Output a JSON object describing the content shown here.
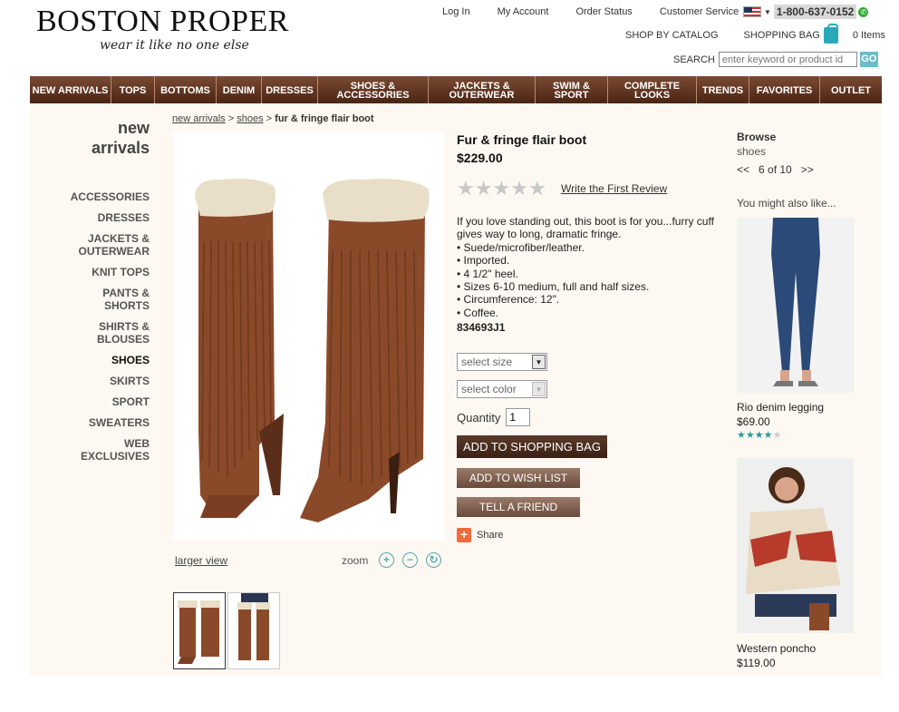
{
  "header": {
    "brand": "BOSTON PROPER",
    "tagline": "wear it like no one else",
    "links": [
      "Log In",
      "My Account",
      "Order Status",
      "Customer Service"
    ],
    "phone": "1-800-637-0152",
    "shop_by_catalog": "SHOP BY CATALOG",
    "shopping_bag": "SHOPPING BAG",
    "bag_count": "0 Items",
    "search_label": "SEARCH",
    "search_placeholder": "enter keyword or product id",
    "go": "GO"
  },
  "nav": [
    "NEW ARRIVALS",
    "TOPS",
    "BOTTOMS",
    "DENIM",
    "DRESSES",
    "SHOES & ACCESSORIES",
    "JACKETS & OUTERWEAR",
    "SWIM & SPORT",
    "COMPLETE LOOKS",
    "TRENDS",
    "FAVORITES",
    "OUTLET"
  ],
  "sidebar": {
    "title": "new arrivals",
    "categories": [
      "ACCESSORIES",
      "DRESSES",
      "JACKETS & OUTERWEAR",
      "KNIT TOPS",
      "PANTS & SHORTS",
      "SHIRTS & BLOUSES",
      "SHOES",
      "SKIRTS",
      "SPORT",
      "SWEATERS",
      "WEB EXCLUSIVES"
    ],
    "active": "SHOES"
  },
  "breadcrumb": {
    "level1": "new arrivals",
    "level2": "shoes",
    "current": "fur & fringe flair boot",
    "sep": ">"
  },
  "gallery": {
    "larger_view": "larger view",
    "zoom": "zoom"
  },
  "product": {
    "name": "Fur & fringe flair boot",
    "price": "$229.00",
    "review_link": "Write the First Review",
    "description": [
      "If you love standing out, this boot is for you...furry cuff gives way to long, dramatic fringe.",
      "• Suede/microfiber/leather.",
      "• Imported.",
      "• 4 1/2\" heel.",
      "• Sizes 6-10 medium, full and half sizes.",
      "• Circumference: 12\".",
      "• Coffee."
    ],
    "sku": "834693J1",
    "size_select": "select size",
    "color_select": "select color",
    "quantity_label": "Quantity",
    "quantity": "1",
    "add_to_bag": "ADD TO SHOPPING BAG",
    "add_to_wish": "ADD TO WISH LIST",
    "tell_friend": "TELL A FRIEND",
    "share": "Share"
  },
  "browse": {
    "title": "Browse",
    "category": "shoes",
    "prev": "<<",
    "position": "6 of 10",
    "next": ">>",
    "also_like": "You might also like...",
    "recs": [
      {
        "name": "Rio denim legging",
        "price": "$69.00",
        "rating": 4
      },
      {
        "name": "Western poncho",
        "price": "$119.00"
      }
    ]
  },
  "colors": {
    "nav_top": "#7a4a33",
    "nav_bottom": "#4a2515",
    "accent_teal": "#2a9a9a",
    "boot_brown": "#8a4a2a"
  }
}
